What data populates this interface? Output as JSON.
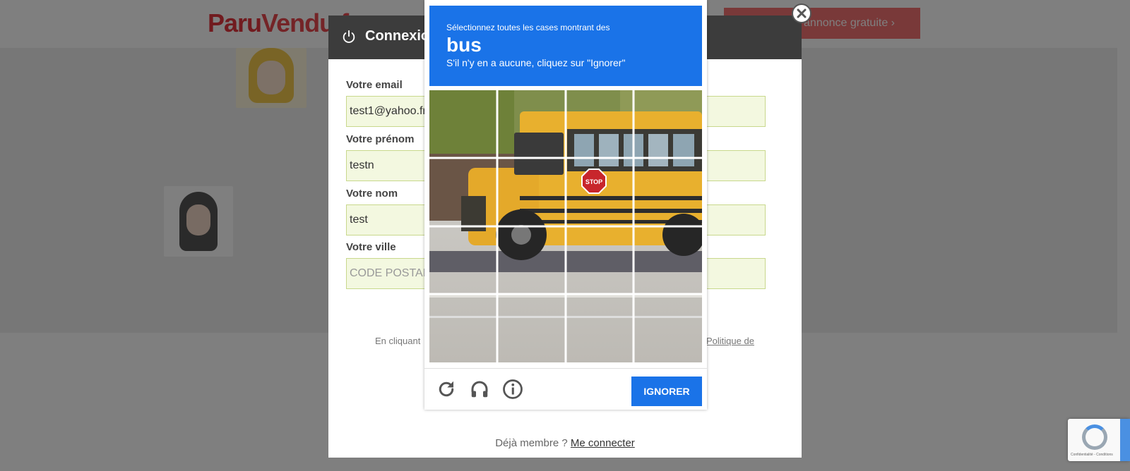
{
  "site": {
    "logo_part1": "Paru",
    "logo_part2": "Vendu.fr",
    "cta_label": "annonce gratuite"
  },
  "modal": {
    "title": "Connexion",
    "fields": [
      {
        "label": "Votre email",
        "value": "test1@yahoo.fr",
        "placeholder": ""
      },
      {
        "label": "Votre prénom",
        "value": "testn",
        "placeholder": ""
      },
      {
        "label": "Votre nom",
        "value": "test",
        "placeholder": ""
      },
      {
        "label": "Votre ville",
        "value": "",
        "placeholder": "CODE POSTAL"
      }
    ],
    "legal_text": "En cliquant",
    "legal_link": "Politique de",
    "member_text": "Déjà membre ?",
    "member_link": "Me connecter"
  },
  "captcha": {
    "instruction_line1": "Sélectionnez toutes les cases montrant des",
    "target": "bus",
    "instruction_line2": "S'il n'y en a aucune, cliquez sur \"Ignorer\"",
    "ignore_label": "IGNORER",
    "stop_sign_text": "STOP",
    "icons": [
      "reload-icon",
      "audio-icon",
      "info-icon"
    ]
  },
  "recaptcha_badge": {
    "text": "Confidentialité - Conditions"
  },
  "colors": {
    "captcha_blue": "#1a73e8",
    "brand_red": "#e2363e",
    "bus_yellow": "#e8b02e"
  }
}
